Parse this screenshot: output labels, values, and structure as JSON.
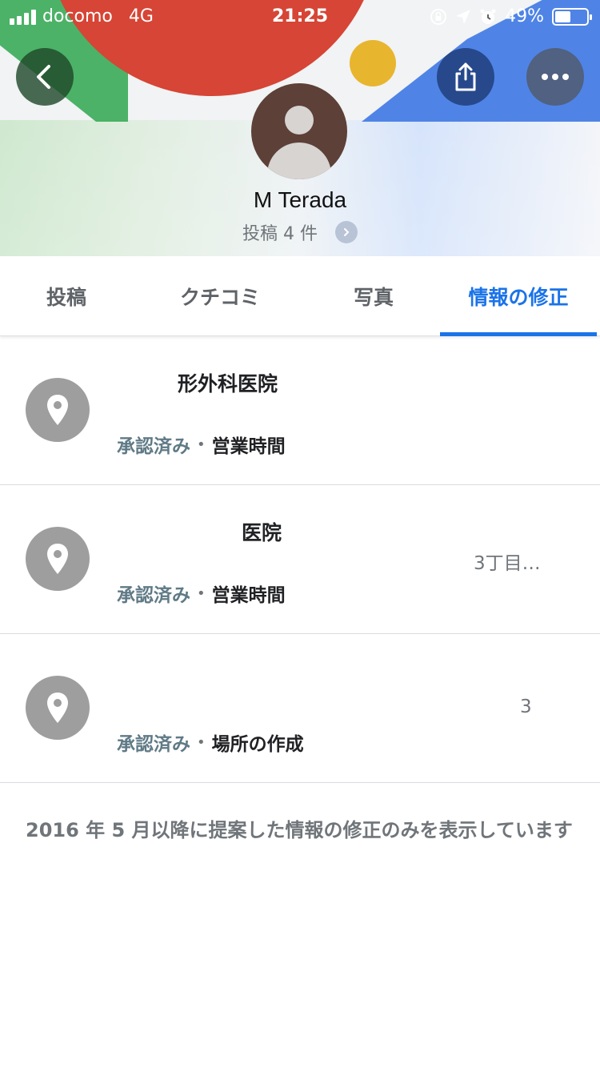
{
  "status_bar": {
    "carrier": "docomo",
    "network": "4G",
    "time": "21:25",
    "battery": "49%",
    "battery_level": 0.49,
    "icons": [
      "orientation-lock-icon",
      "location-arrow-icon",
      "alarm-icon",
      "battery-icon"
    ]
  },
  "header": {
    "back_icon": "chevron-left-icon",
    "share_icon": "share-icon",
    "more_icon": "more-horizontal-icon"
  },
  "profile": {
    "name": "M Terada",
    "post_count": "投稿 4 件"
  },
  "tabs": [
    {
      "label": "投稿",
      "active": false
    },
    {
      "label": "クチコミ",
      "active": false
    },
    {
      "label": "写真",
      "active": false
    },
    {
      "label": "情報の修正",
      "active": true
    }
  ],
  "edits": [
    {
      "name": "形外科医院",
      "address": "",
      "status": "承認済み",
      "type": "営業時間",
      "icon": "map-pin-icon"
    },
    {
      "name": "医院",
      "address": "3丁目…",
      "status": "承認済み",
      "type": "営業時間",
      "icon": "map-pin-icon"
    },
    {
      "name": "",
      "address": "3",
      "status": "承認済み",
      "type": "場所の作成",
      "icon": "map-pin-icon"
    }
  ],
  "footer_note": "2016 年 5 月以降に提案した情報の修正のみを表示しています",
  "colors": {
    "accent": "#1a73e8",
    "status": "#5f7a86",
    "pin": "#9e9e9e",
    "avatar": "#5d4037"
  }
}
